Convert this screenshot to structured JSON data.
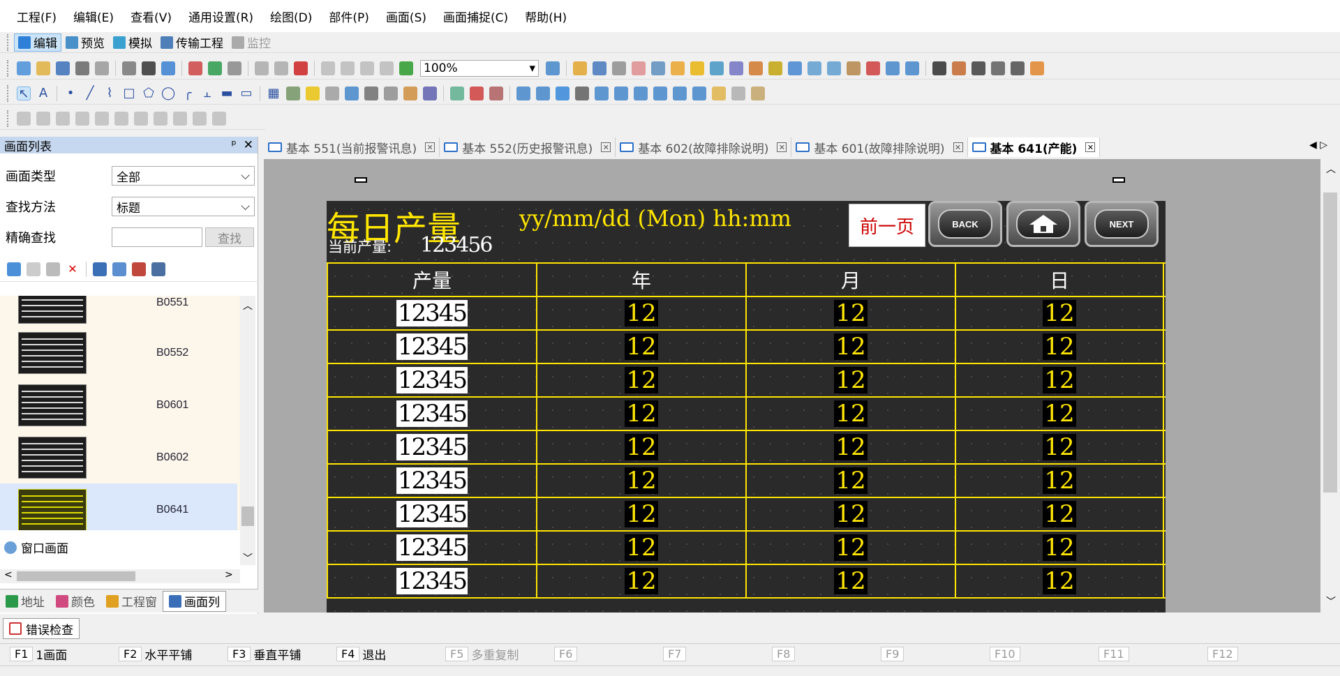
{
  "menu": [
    "工程(F)",
    "编辑(E)",
    "查看(V)",
    "通用设置(R)",
    "绘图(D)",
    "部件(P)",
    "画面(S)",
    "画面捕捉(C)",
    "帮助(H)"
  ],
  "modes": [
    {
      "label": "编辑",
      "active": true
    },
    {
      "label": "预览"
    },
    {
      "label": "模拟"
    },
    {
      "label": "传输工程"
    },
    {
      "label": "监控",
      "disabled": true
    }
  ],
  "zoom": "100%",
  "panel": {
    "title": "画面列表",
    "filter_type_label": "画面类型",
    "filter_type_value": "全部",
    "search_method_label": "查找方法",
    "search_method_value": "标题",
    "exact_label": "精确查找",
    "exact_value": "",
    "search_button": "查找",
    "thumbs": [
      {
        "label": "B0551"
      },
      {
        "label": "B0552"
      },
      {
        "label": "B0601"
      },
      {
        "label": "B0602"
      },
      {
        "label": "B0641",
        "selected": true
      }
    ],
    "tree_item": "窗口画面",
    "tabs": [
      "地址",
      "颜色",
      "工程窗",
      "画面列"
    ]
  },
  "tabs": [
    "基本 551(当前报警讯息)",
    "基本 552(历史报警讯息)",
    "基本 602(故障排除说明)",
    "基本 601(故障排除说明)",
    "基本 641(产能)"
  ],
  "screen": {
    "title": "每日产量",
    "timestamp": "yy/mm/dd (Mon) hh:mm",
    "current_label": "当前产量:",
    "current_value": "123456",
    "prev_page": "前一页",
    "back": "BACK",
    "next": "NEXT",
    "headers": [
      "产量",
      "年",
      "月",
      "日"
    ],
    "rows": [
      [
        "12345",
        "12",
        "12",
        "12"
      ],
      [
        "12345",
        "12",
        "12",
        "12"
      ],
      [
        "12345",
        "12",
        "12",
        "12"
      ],
      [
        "12345",
        "12",
        "12",
        "12"
      ],
      [
        "12345",
        "12",
        "12",
        "12"
      ],
      [
        "12345",
        "12",
        "12",
        "12"
      ],
      [
        "12345",
        "12",
        "12",
        "12"
      ],
      [
        "12345",
        "12",
        "12",
        "12"
      ],
      [
        "12345",
        "12",
        "12",
        "12"
      ]
    ]
  },
  "error_check": "错误检查",
  "fkeys": [
    {
      "key": "F1",
      "label": "1画面"
    },
    {
      "key": "F2",
      "label": "水平平铺"
    },
    {
      "key": "F3",
      "label": "垂直平铺"
    },
    {
      "key": "F4",
      "label": "退出"
    },
    {
      "key": "F5",
      "label": "多重复制",
      "dim": true
    },
    {
      "key": "F6",
      "dim": true
    },
    {
      "key": "F7",
      "dim": true
    },
    {
      "key": "F8",
      "dim": true
    },
    {
      "key": "F9",
      "dim": true
    },
    {
      "key": "F10",
      "dim": true
    },
    {
      "key": "F11",
      "dim": true
    },
    {
      "key": "F12",
      "dim": true
    }
  ],
  "colors": {
    "accent": "#ffe600",
    "screen_bg": "#2a2a2a",
    "selection": "#dbe8fb"
  }
}
